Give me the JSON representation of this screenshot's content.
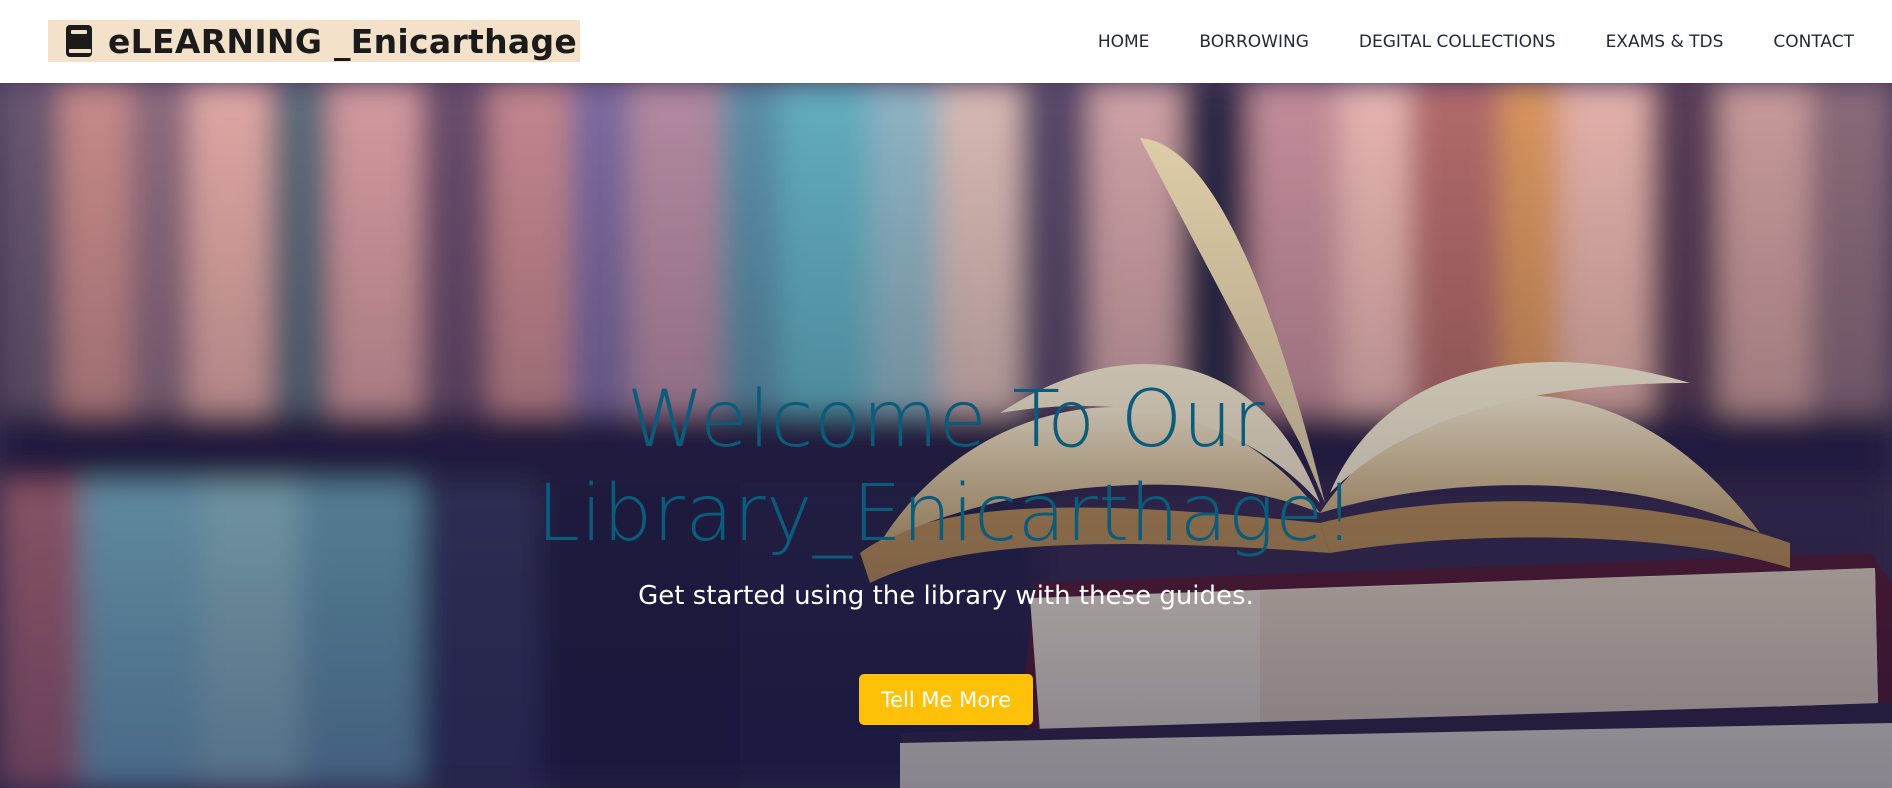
{
  "brand": {
    "title": "eLEARNING _Enicarthage",
    "icon": "book-icon"
  },
  "nav": {
    "items": [
      "HOME",
      "BORROWING",
      "DEGITAL COLLECTIONS",
      "EXAMS & TDS",
      "CONTACT"
    ]
  },
  "hero": {
    "title_line1": "Welcome To Our",
    "title_line2": "Library_Enicarthage!",
    "subtitle": "Get started using the library with these guides.",
    "cta_label": "Tell Me More",
    "background": "blurred-bookshelf-with-open-book-photo"
  },
  "colors": {
    "brand_bg": "#f3e1c9",
    "title": "#0b5b7a",
    "cta": "#ffc107",
    "nav_text": "#222a3a"
  }
}
